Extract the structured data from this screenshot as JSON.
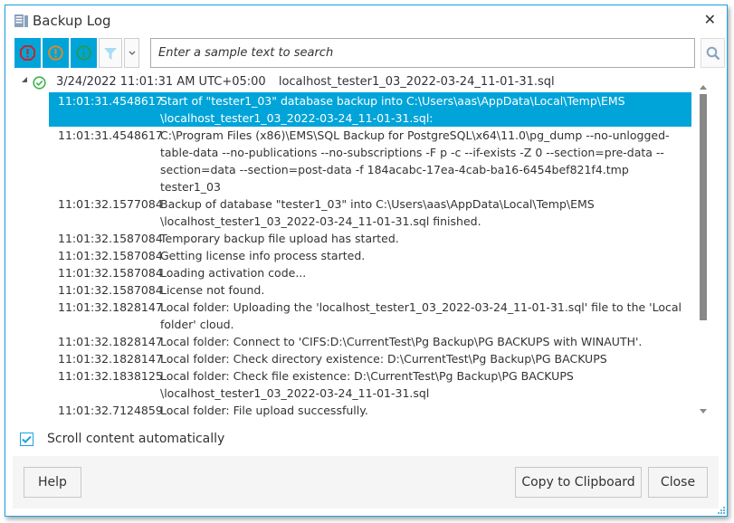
{
  "window": {
    "title": "Backup Log",
    "close_icon": "close-icon",
    "app_icon": "document-log-icon"
  },
  "toolbar": {
    "buttons": [
      {
        "name": "errors-filter",
        "icon": "error-octagon-icon",
        "color": "#c0282d"
      },
      {
        "name": "warnings-filter",
        "icon": "warning-circle-icon",
        "color": "#d98a2b"
      },
      {
        "name": "info-filter",
        "icon": "info-circle-icon",
        "color": "#1f9e5a"
      }
    ],
    "filter_icon": "funnel-icon",
    "dropdown_icon": "chevron-down-icon",
    "search_placeholder": "Enter a sample text to search",
    "search_value": "",
    "search_icon": "search-icon"
  },
  "log": {
    "session": {
      "status_icon": "check-circle-icon",
      "timestamp": "3/24/2022 11:01:31 AM UTC+05:00",
      "file": "localhost_tester1_03_2022-03-24_11-01-31.sql"
    },
    "entries": [
      {
        "time": "11:01:31.4548617",
        "message": "Start of \"tester1_03\" database backup into C:\\Users\\aas\\AppData\\Local\\Temp\\EMS \\localhost_tester1_03_2022-03-24_11-01-31.sql:",
        "selected": true
      },
      {
        "time": "11:01:31.4548617",
        "message": "C:\\Program Files (x86)\\EMS\\SQL Backup for PostgreSQL\\x64\\11.0\\pg_dump --no-unlogged-table-data --no-publications --no-subscriptions -F p -c --if-exists -Z 0 --section=pre-data --section=data --section=post-data -f 184acabc-17ea-4cab-ba16-6454bef821f4.tmp tester1_03",
        "selected": false
      },
      {
        "time": "11:01:32.1577084",
        "message": "Backup of database \"tester1_03\" into C:\\Users\\aas\\AppData\\Local\\Temp\\EMS \\localhost_tester1_03_2022-03-24_11-01-31.sql finished.",
        "selected": false
      },
      {
        "time": "11:01:32.1587084",
        "message": "Temporary backup file upload has started.",
        "selected": false
      },
      {
        "time": "11:01:32.1587084",
        "message": "Getting license info process started.",
        "selected": false
      },
      {
        "time": "11:01:32.1587084",
        "message": "Loading activation code...",
        "selected": false
      },
      {
        "time": "11:01:32.1587084",
        "message": "License not found.",
        "selected": false
      },
      {
        "time": "11:01:32.1828147",
        "message": "Local folder: Uploading the 'localhost_tester1_03_2022-03-24_11-01-31.sql' file to the 'Local folder' cloud.",
        "selected": false
      },
      {
        "time": "11:01:32.1828147",
        "message": "Local folder: Connect to 'CIFS:D:\\CurrentTest\\Pg Backup\\PG BACKUPS with WINAUTH'.",
        "selected": false
      },
      {
        "time": "11:01:32.1828147",
        "message": "Local folder: Check directory existence: D:\\CurrentTest\\Pg Backup\\PG BACKUPS",
        "selected": false
      },
      {
        "time": "11:01:32.1838125",
        "message": "Local folder: Check file existence: D:\\CurrentTest\\Pg Backup\\PG BACKUPS \\localhost_tester1_03_2022-03-24_11-01-31.sql",
        "selected": false
      },
      {
        "time": "11:01:32.7124859",
        "message": "Local folder: File upload successfully.",
        "selected": false
      }
    ]
  },
  "options": {
    "auto_scroll_label": "Scroll content automatically",
    "auto_scroll_checked": true
  },
  "footer": {
    "help_label": "Help",
    "copy_label": "Copy to Clipboard",
    "close_label": "Close"
  },
  "colors": {
    "accent": "#00a4d9",
    "window_border": "#1ba1e2",
    "footer_bg": "#f5f5f5"
  }
}
